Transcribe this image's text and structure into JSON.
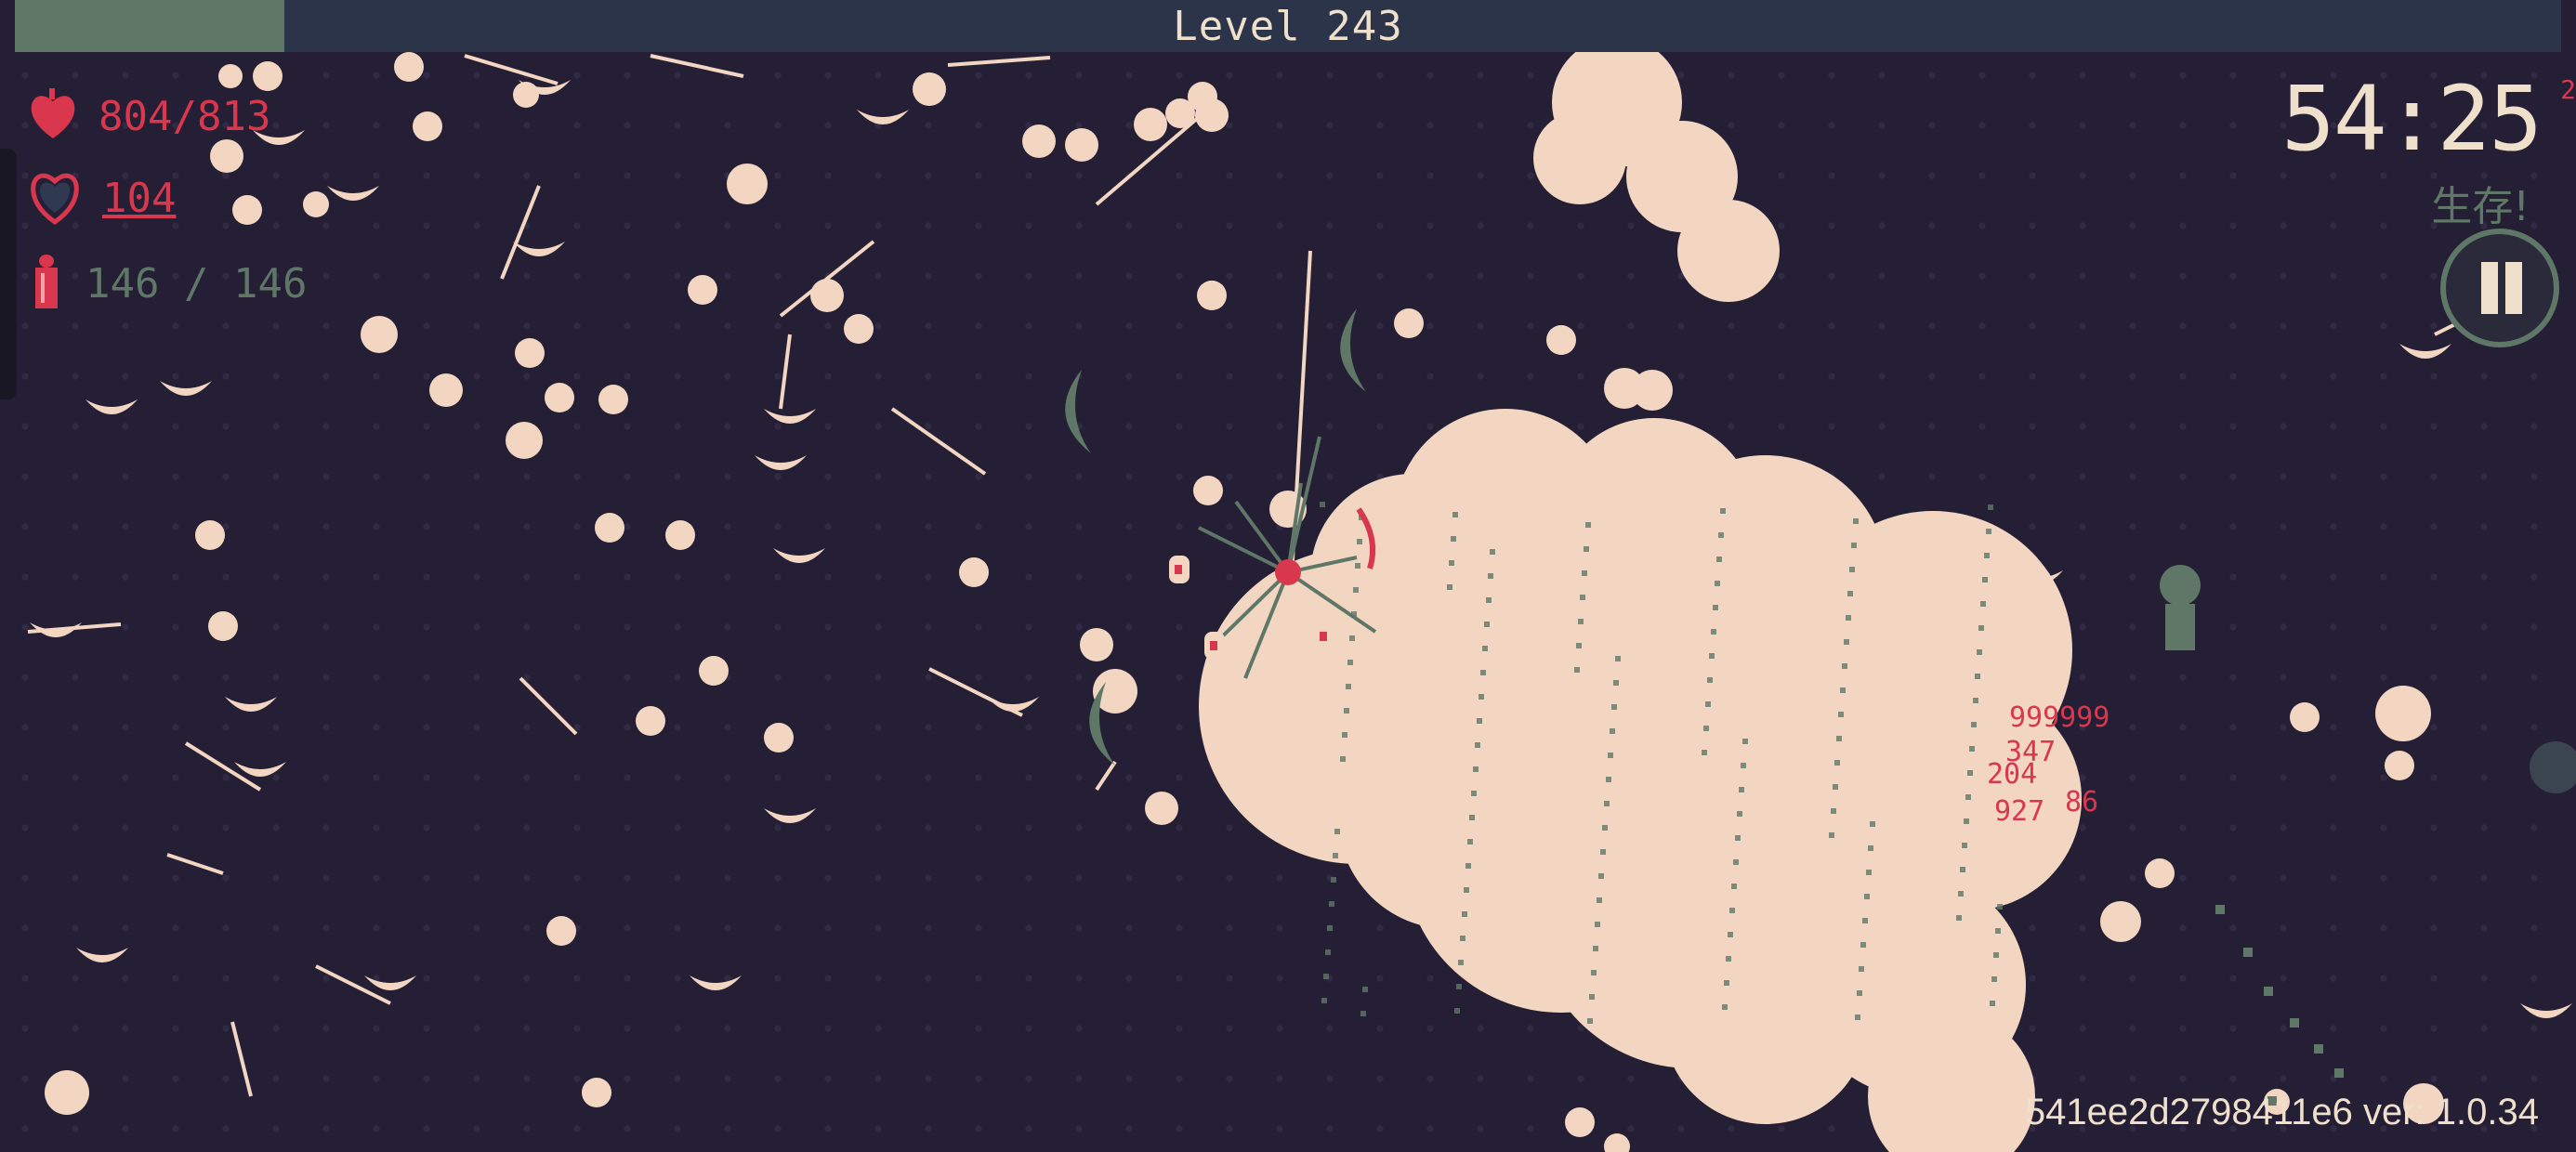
{
  "hud": {
    "level_label": "Level 243",
    "xp_progress": 0.106,
    "health": "804/813",
    "armor": "104",
    "ammo_current": "146",
    "ammo_separator": "/",
    "ammo_max": "146",
    "timer": "54:25",
    "objective": "生存!",
    "version": "541ee2d2798411e6 ver: 1.0.34",
    "edge_marker": "2"
  },
  "damage_numbers": [
    "999999",
    "347",
    "204",
    "927",
    "86"
  ],
  "icons": {
    "health": "heart-icon",
    "armor": "shield-heart-icon",
    "ammo": "bullet-icon",
    "pause": "pause-icon"
  },
  "colors": {
    "background": "#231f33",
    "xp_bar": "#2b3448",
    "xp_fill": "#5f7766",
    "text_light": "#efe0cc",
    "accent_red": "#d8374e",
    "muted_green": "#5f7766",
    "projectile": "#f3d6c2"
  }
}
